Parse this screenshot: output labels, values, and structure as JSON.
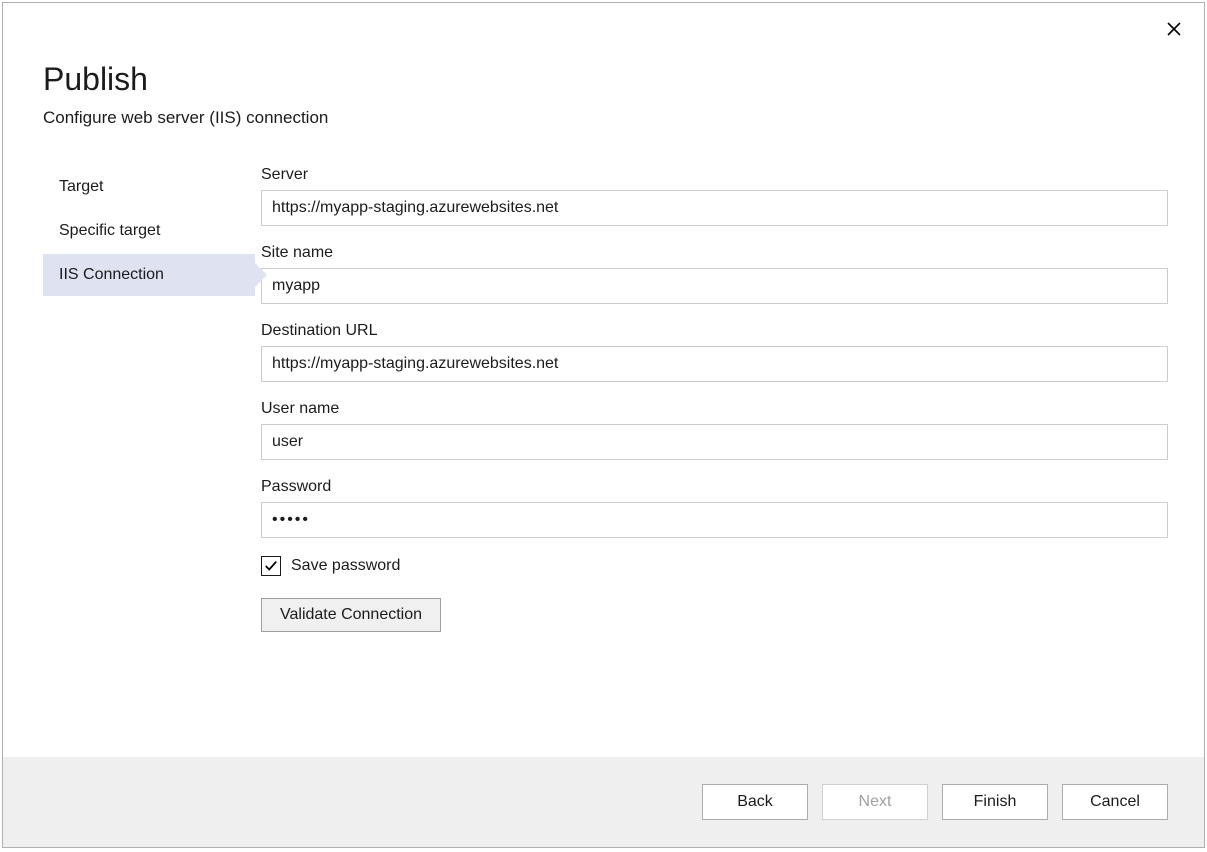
{
  "dialog": {
    "title": "Publish",
    "subtitle": "Configure web server (IIS) connection"
  },
  "sidebar": {
    "items": [
      {
        "label": "Target",
        "active": false
      },
      {
        "label": "Specific target",
        "active": false
      },
      {
        "label": "IIS Connection",
        "active": true
      }
    ]
  },
  "form": {
    "server_label": "Server",
    "server_value": "https://myapp-staging.azurewebsites.net",
    "site_name_label": "Site name",
    "site_name_value": "myapp",
    "destination_url_label": "Destination URL",
    "destination_url_value": "https://myapp-staging.azurewebsites.net",
    "user_name_label": "User name",
    "user_name_value": "user",
    "password_label": "Password",
    "password_value": "•••••",
    "save_password_label": "Save password",
    "save_password_checked": true,
    "validate_button_label": "Validate Connection"
  },
  "footer": {
    "back_label": "Back",
    "next_label": "Next",
    "next_enabled": false,
    "finish_label": "Finish",
    "cancel_label": "Cancel"
  }
}
